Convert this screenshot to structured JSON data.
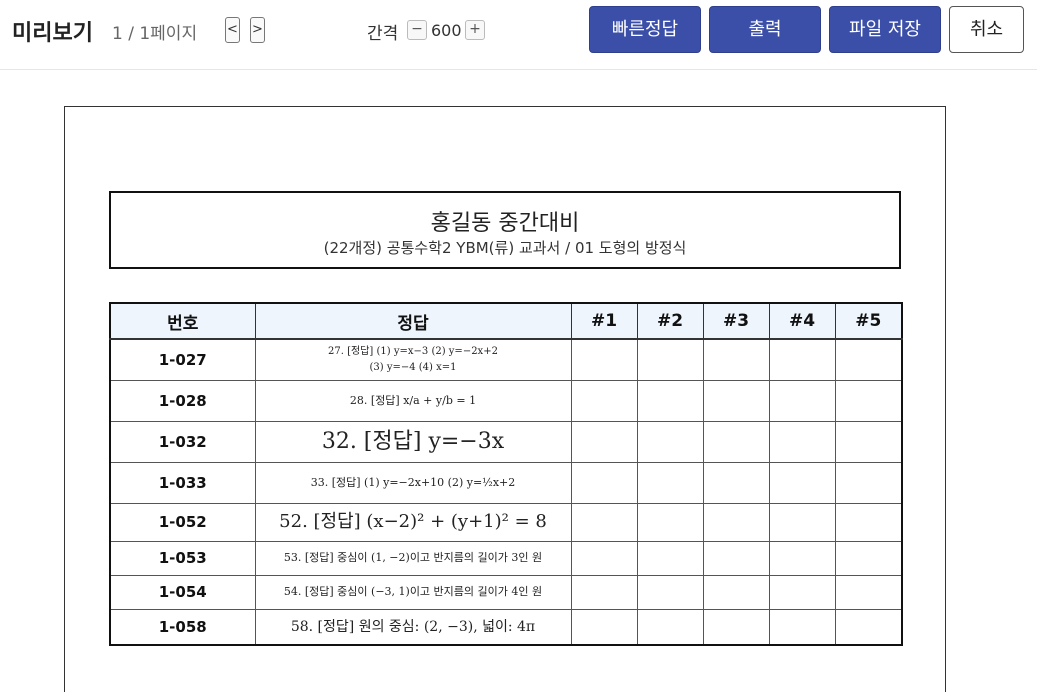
{
  "toolbar": {
    "title": "미리보기",
    "page_info": "1 / 1페이지",
    "prev_label": "<",
    "next_label": ">",
    "gap_label": "간격",
    "gap_minus": "−",
    "gap_value": "600",
    "gap_plus": "+",
    "quick_answer_label": "빠른정답",
    "print_label": "출력",
    "save_label": "파일 저장",
    "cancel_label": "취소"
  },
  "document": {
    "title": "홍길동 중간대비",
    "subtitle": "(22개정) 공통수학2 YBM(류) 교과서 / 01 도형의 방정식"
  },
  "table": {
    "headers": [
      "번호",
      "정답",
      "#1",
      "#2",
      "#3",
      "#4",
      "#5"
    ],
    "rows": [
      {
        "code": "1-027",
        "answer_line1": "27. [정답] (1) y=x−3                (2) y=−2x+2",
        "answer_line2": "(3) y=−4            (4) x=1"
      },
      {
        "code": "1-028",
        "answer_line1": "28. [정답] x/a + y/b = 1"
      },
      {
        "code": "1-032",
        "answer_line1": "32. [정답] y=−3x"
      },
      {
        "code": "1-033",
        "answer_line1": "33. [정답] (1) y=−2x+10     (2) y=½x+2"
      },
      {
        "code": "1-052",
        "answer_line1": "52. [정답] (x−2)² + (y+1)² = 8"
      },
      {
        "code": "1-053",
        "answer_line1": "53. [정답] 중심이 (1, −2)이고 반지름의 길이가 3인 원"
      },
      {
        "code": "1-054",
        "answer_line1": "54. [정답] 중심이 (−3, 1)이고 반지름의 길이가 4인 원"
      },
      {
        "code": "1-058",
        "answer_line1": "58. [정답] 원의 중심: (2, −3), 넓이: 4π"
      }
    ]
  }
}
